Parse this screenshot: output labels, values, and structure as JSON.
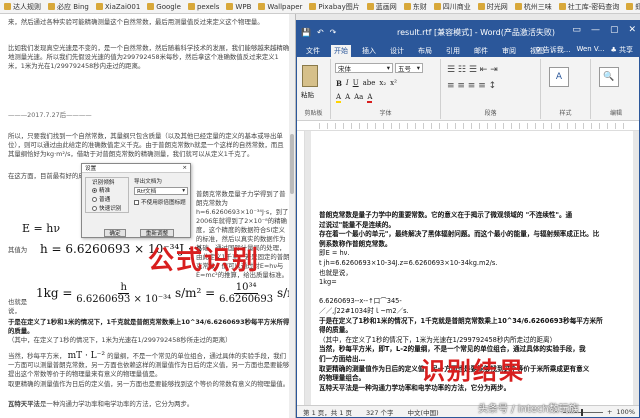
{
  "bookmarks": [
    "达人规则",
    "必应 Bing",
    "XiaZai001",
    "Google",
    "pexels",
    "WPB",
    "Wallpaper",
    "Pixabay图片",
    "蓝画网",
    "东财",
    "四川商业",
    "时光网",
    "杭州三味",
    "社工库-密码查询",
    "虾米",
    "淘宝个人赛专送",
    "北京市旅游厅"
  ],
  "browser": {
    "para1": "来，然后通过各种实验可能精确测量这个自然常数，最后用测量值反过来定义这个物理量。",
    "para2": "比如我们发现真空光速是不变的，是一个自然常数，然后随着科学技术的发展，我们能够越来越精确地测量光速。所以我们先假设光速的值为299792458米每秒，然后拿这个准确数值反过来定义1米，1米为光在1/299792458秒内走过的距离。",
    "date_sep": "———2017.7.27后————",
    "para3": "所以，只要我们找到一个自然常数，其量纲只包含质量（以及其他已经定量的定义的基本或导出单位），则可以通过由此给定的准确数值定义千克。由于普朗克常数h就是一个这样的自然常数，而且其量纲恰好为kg·m²/s，借助于对普朗克常数的精确测量，我们就可以从定义1千克了。",
    "para4": "在这方面，目前最有好的成果是：",
    "para5": "普朗克常数是量子力学得到了普朗克常数为h=6.6260693×10⁻³⁴J·s，到了2006年就得到了2×10⁻⁸的精确度，这个精度的数据符合SI定义的标准，然后以真实的数据作为基础，通过国际计量局的处理，由此定义1千克，若是固定的普朗克常数，便可以通过对E=hν与E=mc²的推算，给出质量标准。",
    "eq_e": "E = hν",
    "eq_h_prefix": "其值为",
    "eq_h": "h = 6.6260693 × 10⁻³⁴J · s",
    "eq_kg_left": "1kg =",
    "eq_kg_frac1_num": "h",
    "eq_kg_frac1_den": "6.6260693 × 10⁻³⁴",
    "eq_kg_mid": "s/m² =",
    "eq_kg_frac2_num": "10³⁴",
    "eq_kg_frac2_den": "6.6260693",
    "eq_kg_right": "s/m² · h",
    "also_label": "也就是说，",
    "bold1": "于是在定义了1秒和1米的情况下，1千克就是普朗克常数乘上10^34/6.6260693秒每平方米所得的质量。",
    "para6": "（其中，在定义了1秒的情况下，1米为光速在1/299792458秒所走过的距离）",
    "para7_prefix": "当然，秒每平方米，",
    "eq_mtl": "mT · L⁻²",
    "para7_rest": "的量纲，不是一个常见的单位组合，通过具体的实验手段，我们一方面可以测量普朗克常数，另一方面也依赖这样的测量值作为日后的定义值，另一方面也是要能够提出这个常数等价于的物理量来有意义的物理量值是。",
    "para8": "取更精确的测量值作为日后的定义值，另一方面也是要能够找到这个等价的常数有意义的物理量值。",
    "bold2": "瓦特天平法",
    "para9": "是一种沟通力学功率和电学功率的方法，它分为两步。",
    "overlay_left": "公式识别"
  },
  "dialog": {
    "title": "设置",
    "close": "×",
    "group_label": "识别倾斜",
    "radio1": "精准",
    "radio2": "普通",
    "radio3": "快速识别",
    "right_label": "导出文档为",
    "select_value": "Rtf文档",
    "check1": "不使用原倍图标题",
    "ok": "确定",
    "cancel": "重新调整"
  },
  "word": {
    "title": "result.rtf [兼容模式] - Word(产品激活失败)",
    "qat_save": "💾",
    "qat_undo": "↶",
    "qat_redo": "↷",
    "win_min": "—",
    "win_max": "▢",
    "win_close": "✕",
    "win_ribbon": "▭",
    "tabs": [
      "文件",
      "开始",
      "插入",
      "设计",
      "布局",
      "引用",
      "邮件",
      "审阅",
      "视图"
    ],
    "tell_me": "♀ 告诉我...",
    "user": "Wen V...",
    "share": "♣ 共享",
    "paste": "粘贴",
    "clipboard_label": "剪贴板",
    "font_name": "宋体",
    "font_size": "五号",
    "font_label": "字体",
    "format_buttons": [
      "B",
      "I",
      "U",
      "abe",
      "x₂",
      "x²"
    ],
    "color_buttons": [
      "A",
      "A",
      "Aa",
      "A"
    ],
    "paragraph_label": "段落",
    "styles_label": "样式",
    "styles_icon": "A",
    "editing_label": "编辑",
    "editing_icon": "🔍",
    "doc_lines": [
      {
        "t": "普朗克常数是量子力学中的重要常数。它的意义在于揭示了微观领域的 \"不连续性\"。通",
        "b": true
      },
      {
        "t": "过说过\"能量不是连续的。",
        "b": true
      },
      {
        "t": "存在着一个最小的单元\"，最终解决了黑体辐射问题。而这个最小的能量，与辐射频率成正比。比",
        "b": true
      },
      {
        "t": "例系数称作普朗克常数。",
        "b": true
      },
      {
        "t": "即E = hν.",
        "b": false
      },
      {
        "t": "  t jh=6.6260693×10-34J.z=6.6260693×10-34kg.m2/s.",
        "b": false
      },
      {
        "t": "也就是说，",
        "b": false
      },
      {
        "t": "1kg=",
        "b": false
      },
      {
        "t": "",
        "b": false
      },
      {
        "t": "6.6260693--x--↑口⌒345-",
        "b": false
      },
      {
        "t": "／／,ʃ22#1034时ｌ~m2／s.",
        "b": false
      },
      {
        "t": "于是在定义了1秒和1米的情况下，1千克就是普朗克常数乘上10^34/6.6260693秒每平方米所",
        "b": true
      },
      {
        "t": "得的质量。",
        "b": true
      },
      {
        "t": "（其中，在定义了1秒的情况下，1米为光速在1/299792458秒内所走过的距离）",
        "b": false
      },
      {
        "t": "当然，秒每平方米，即T，L-2的量纲，不是一个常见的单位组合，通过具体的实验手段，我",
        "b": true
      },
      {
        "t": "们一方面给出…",
        "b": true
      },
      {
        "t": "取更精确的测量值作为日后的定义值，另一方面也是要能够找到这个等价于米所乘成更有意义",
        "b": true
      },
      {
        "t": "的物理量组合。",
        "b": true
      },
      {
        "t": "瓦特天平法是一种沟通力学功率和电学功率的方法，它分为两步。",
        "b": true
      }
    ],
    "overlay_right": "识别结果",
    "status_page": "第 1 页，共 1 页",
    "status_words": "327 个字",
    "status_lang": "中文(中国)",
    "zoom": "100%"
  },
  "watermark": "头条号 / intech数玩族"
}
